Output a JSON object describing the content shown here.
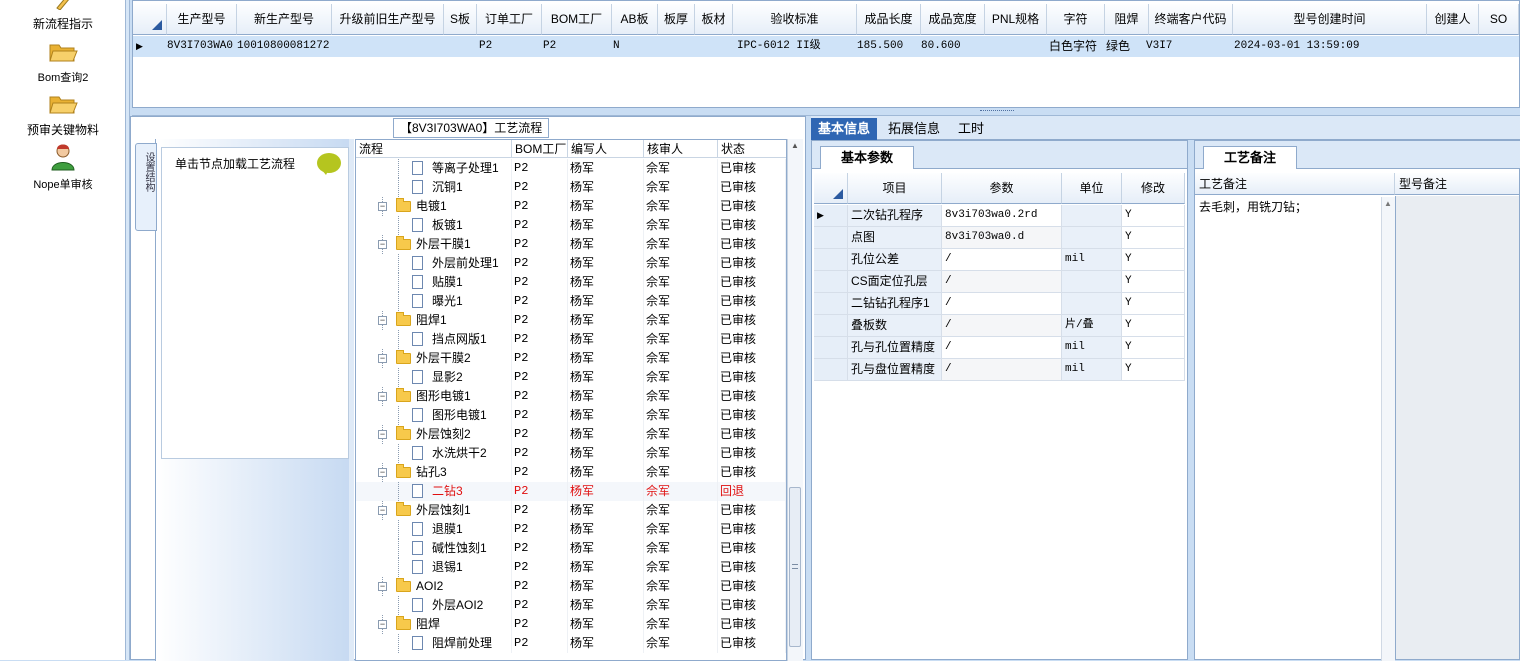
{
  "sidebar": {
    "items": [
      {
        "label": "新流程指示",
        "icon": "pencil-icon"
      },
      {
        "label": "Bom查询2",
        "icon": "folder-open-icon"
      },
      {
        "label": "预审关键物料",
        "icon": "folder-open-icon"
      },
      {
        "label": "Nope单审核",
        "icon": "user-icon"
      }
    ]
  },
  "top_grid": {
    "columns": [
      "生产型号",
      "新生产型号",
      "升级前旧生产型号",
      "S板",
      "订单工厂",
      "BOM工厂",
      "AB板",
      "板厚",
      "板材",
      "验收标准",
      "成品长度",
      "成品宽度",
      "PNL规格",
      "字符",
      "阻焊",
      "终端客户代码",
      "型号创建时间",
      "创建人",
      "SO"
    ],
    "row": {
      "prod_model": "8V3I703WA0",
      "new_model": "10010800081272",
      "old_model": "",
      "s_board": "",
      "order_factory": "P2",
      "bom_factory": "P2",
      "ab_board": "N",
      "thickness": "",
      "material": "",
      "standard": "IPC-6012 II级",
      "length": "185.500",
      "width": "80.600",
      "pnl": "",
      "char": "白色字符",
      "mask": "绿色",
      "customer": "V3I7",
      "created": "2024-03-01 13:59:09",
      "creator": "",
      "so": ""
    }
  },
  "process": {
    "title": "【8V3I703WA0】工艺流程",
    "side_tab": "设置结构",
    "node_hint": "单击节点加载工艺流程",
    "columns": [
      "流程",
      "BOM工厂",
      "编写人",
      "核审人",
      "状态"
    ],
    "rows": [
      {
        "name": "等离子处理1",
        "level": 2,
        "bom": "P2",
        "writer": "杨军",
        "auditor": "佘军",
        "status": "已审核"
      },
      {
        "name": "沉铜1",
        "level": 2,
        "bom": "P2",
        "writer": "杨军",
        "auditor": "佘军",
        "status": "已审核"
      },
      {
        "name": "电镀1",
        "level": 1,
        "bom": "P2",
        "writer": "杨军",
        "auditor": "佘军",
        "status": "已审核"
      },
      {
        "name": "板镀1",
        "level": 2,
        "bom": "P2",
        "writer": "杨军",
        "auditor": "佘军",
        "status": "已审核"
      },
      {
        "name": "外层干膜1",
        "level": 1,
        "bom": "P2",
        "writer": "杨军",
        "auditor": "佘军",
        "status": "已审核"
      },
      {
        "name": "外层前处理1",
        "level": 2,
        "bom": "P2",
        "writer": "杨军",
        "auditor": "佘军",
        "status": "已审核"
      },
      {
        "name": "贴膜1",
        "level": 2,
        "bom": "P2",
        "writer": "杨军",
        "auditor": "佘军",
        "status": "已审核"
      },
      {
        "name": "曝光1",
        "level": 2,
        "bom": "P2",
        "writer": "杨军",
        "auditor": "佘军",
        "status": "已审核"
      },
      {
        "name": "阻焊1",
        "level": 1,
        "bom": "P2",
        "writer": "杨军",
        "auditor": "佘军",
        "status": "已审核"
      },
      {
        "name": "挡点网版1",
        "level": 2,
        "bom": "P2",
        "writer": "杨军",
        "auditor": "佘军",
        "status": "已审核"
      },
      {
        "name": "外层干膜2",
        "level": 1,
        "bom": "P2",
        "writer": "杨军",
        "auditor": "佘军",
        "status": "已审核"
      },
      {
        "name": "显影2",
        "level": 2,
        "bom": "P2",
        "writer": "杨军",
        "auditor": "佘军",
        "status": "已审核"
      },
      {
        "name": "图形电镀1",
        "level": 1,
        "bom": "P2",
        "writer": "杨军",
        "auditor": "佘军",
        "status": "已审核"
      },
      {
        "name": "图形电镀1",
        "level": 2,
        "bom": "P2",
        "writer": "杨军",
        "auditor": "佘军",
        "status": "已审核"
      },
      {
        "name": "外层蚀刻2",
        "level": 1,
        "bom": "P2",
        "writer": "杨军",
        "auditor": "佘军",
        "status": "已审核"
      },
      {
        "name": "水洗烘干2",
        "level": 2,
        "bom": "P2",
        "writer": "杨军",
        "auditor": "佘军",
        "status": "已审核"
      },
      {
        "name": "钻孔3",
        "level": 1,
        "bom": "P2",
        "writer": "杨军",
        "auditor": "佘军",
        "status": "已审核"
      },
      {
        "name": "二钻3",
        "level": 2,
        "bom": "P2",
        "writer": "杨军",
        "auditor": "佘军",
        "status": "回退",
        "highlight": true
      },
      {
        "name": "外层蚀刻1",
        "level": 1,
        "bom": "P2",
        "writer": "杨军",
        "auditor": "佘军",
        "status": "已审核"
      },
      {
        "name": "退膜1",
        "level": 2,
        "bom": "P2",
        "writer": "杨军",
        "auditor": "佘军",
        "status": "已审核"
      },
      {
        "name": "碱性蚀刻1",
        "level": 2,
        "bom": "P2",
        "writer": "杨军",
        "auditor": "佘军",
        "status": "已审核"
      },
      {
        "name": "退锡1",
        "level": 2,
        "bom": "P2",
        "writer": "杨军",
        "auditor": "佘军",
        "status": "已审核"
      },
      {
        "name": "AOI2",
        "level": 1,
        "bom": "P2",
        "writer": "杨军",
        "auditor": "佘军",
        "status": "已审核"
      },
      {
        "name": "外层AOI2",
        "level": 2,
        "bom": "P2",
        "writer": "杨军",
        "auditor": "佘军",
        "status": "已审核"
      },
      {
        "name": "阻焊",
        "level": 1,
        "bom": "P2",
        "writer": "杨军",
        "auditor": "佘军",
        "status": "已审核"
      },
      {
        "name": "阻焊前处理",
        "level": 2,
        "bom": "P2",
        "writer": "杨军",
        "auditor": "佘军",
        "status": "已审核"
      }
    ]
  },
  "right_tabs": [
    "基本信息",
    "拓展信息",
    "工时"
  ],
  "basic": {
    "tab": "基本参数",
    "columns": [
      "项目",
      "参数",
      "单位",
      "修改"
    ],
    "rows": [
      {
        "item": "二次钻孔程序",
        "param": "8v3i703wa0.2rd",
        "unit": "",
        "edit": "Y"
      },
      {
        "item": "点图",
        "param": "8v3i703wa0.d",
        "unit": "",
        "edit": "Y"
      },
      {
        "item": "孔位公差",
        "param": "/",
        "unit": "mil",
        "edit": "Y"
      },
      {
        "item": "CS面定位孔层",
        "param": "/",
        "unit": "",
        "edit": "Y"
      },
      {
        "item": "二钻钻孔程序1",
        "param": "/",
        "unit": "",
        "edit": "Y"
      },
      {
        "item": "叠板数",
        "param": "/",
        "unit": "片/叠",
        "edit": "Y"
      },
      {
        "item": "孔与孔位置精度",
        "param": "/",
        "unit": "mil",
        "edit": "Y"
      },
      {
        "item": "孔与盘位置精度",
        "param": "/",
        "unit": "mil",
        "edit": "Y"
      }
    ]
  },
  "notes": {
    "tab": "工艺备注",
    "col1": "工艺备注",
    "col2": "型号备注",
    "text": "去毛刺，用铣刀钻；"
  },
  "colors": {
    "accent": "#2f66b3",
    "panel_bg": "#c9ddf3",
    "rollback": "#e01010"
  }
}
